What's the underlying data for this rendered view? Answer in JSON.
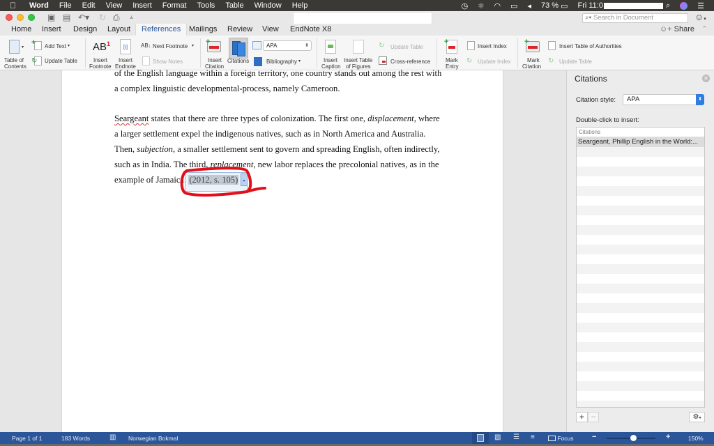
{
  "menubar": {
    "app": "Word",
    "items": [
      "File",
      "Edit",
      "View",
      "Insert",
      "Format",
      "Tools",
      "Table",
      "Window",
      "Help"
    ],
    "battery": "73 %",
    "clock": "Fri 11:0"
  },
  "toolbar": {
    "search_placeholder": "Search in Document"
  },
  "tabs": [
    "Home",
    "Insert",
    "Design",
    "Layout",
    "References",
    "Mailings",
    "Review",
    "View",
    "EndNote X8"
  ],
  "active_tab": "References",
  "share_label": "Share",
  "ribbon": {
    "toc": "Table of Contents",
    "toc_line1": "Table of",
    "toc_line2": "Contents",
    "add_text": "Add Text",
    "update_table": "Update Table",
    "insert_footnote_1": "Insert",
    "insert_footnote_2": "Footnote",
    "insert_endnote_1": "Insert",
    "insert_endnote_2": "Endnote",
    "next_footnote": "Next Footnote",
    "show_notes": "Show Notes",
    "insert_citation_1": "Insert",
    "insert_citation_2": "Citation",
    "citations": "Citations",
    "style_value": "APA",
    "bibliography": "Bibliography",
    "insert_caption_1": "Insert",
    "insert_caption_2": "Caption",
    "insert_tof_1": "Insert Table",
    "insert_tof_2": "of Figures",
    "update_table_captions": "Update Table",
    "cross_reference": "Cross-reference",
    "mark_entry_1": "Mark",
    "mark_entry_2": "Entry",
    "insert_index": "Insert Index",
    "update_index": "Update Index",
    "mark_citation_1": "Mark",
    "mark_citation_2": "Citation",
    "insert_toa": "Insert Table of Authorities",
    "update_table_toa": "Update Table"
  },
  "document": {
    "lines": [
      "of the English language within a foreign territory, one country stands out among the rest with",
      "a complex linguistic developmental-process, namely Cameroon."
    ],
    "p2": {
      "l1_a": "Seargeant",
      "l1_b": " states that there are three types of colonization. The first one, ",
      "l1_i": "displacement",
      "l1_c": ", where",
      "l2": "a larger settlement expel the indigenous natives, such as in North America and Australia.",
      "l3_a": "Then, ",
      "l3_i": "subjection",
      "l3_b": ", a smaller settlement sent to govern and spreading English, often indirectly,",
      "l4_a": "such as in India. The third, ",
      "l4_i": "replacement",
      "l4_b": ", new labor replaces the precolonial natives, as in the",
      "l5_a": "example of Jamaica.",
      "citation": "(2012, s. 105)"
    }
  },
  "panel": {
    "title": "Citations",
    "style_label": "Citation style:",
    "style_value": "APA",
    "insert_hint": "Double-click to insert:",
    "list_header": "Citations",
    "entries": [
      "Seargeant, Phillip English in the World:..."
    ]
  },
  "statusbar": {
    "page": "Page 1 of 1",
    "words": "183 Words",
    "language": "Norwegian Bokmal",
    "focus": "Focus",
    "zoom": "150%",
    "zoom_level_percent": 150
  },
  "colors": {
    "accent": "#2b579a",
    "annotation": "#e0101a"
  }
}
